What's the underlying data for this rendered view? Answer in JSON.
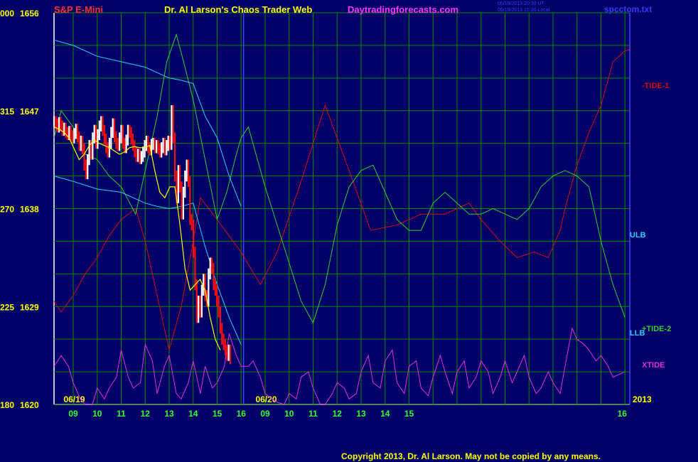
{
  "header": {
    "symbol": "S&P E-Mini",
    "title": "Dr. Al Larson's Chaos Trader Web",
    "site": "Daytradingforecasts.com",
    "stamp_ut": "06/19/2013 20:30 UT",
    "stamp_local": "06/19/2013 15:30 Local",
    "file": "spcctom.txt"
  },
  "footer": {
    "copyright": "Copyright 2013, Dr. Al Larson. May not be copied by any means."
  },
  "colors": {
    "background": "#000066",
    "grid": "#008800",
    "tide1": "#cc1111",
    "tide2": "#33cc33",
    "xtide": "#dd33dd",
    "bands": "#33ccff",
    "price_up": "#ffffff",
    "price_down": "#ee1111",
    "moving_avg": "#ffff00",
    "now_line": "#4444ff"
  },
  "chart_data": {
    "type": "line",
    "x_unit": "hour of day (two sessions, 06/19 and 06/20)",
    "y_left_labels": [
      {
        "left": "000",
        "right": "1656",
        "value": 1656
      },
      {
        "left": "315",
        "right": "1647",
        "value": 1647
      },
      {
        "left": "270",
        "right": "1638",
        "value": 1638
      },
      {
        "left": "225",
        "right": "1629",
        "value": 1629
      },
      {
        "left": "180",
        "right": "1620",
        "value": 1620
      }
    ],
    "ylim": [
      1620,
      1656
    ],
    "x_ticks": [
      "09",
      "10",
      "11",
      "12",
      "13",
      "14",
      "15",
      "16",
      "09",
      "10",
      "11",
      "12",
      "13",
      "14",
      "15",
      "16"
    ],
    "date_labels": [
      "06/19",
      "06/20"
    ],
    "year_label": "2013",
    "series_labels": [
      "-TIDE-1",
      "+TIDE-2",
      "ULB",
      "LLB",
      "XTIDE"
    ],
    "series": [
      {
        "name": "-TIDE-1",
        "x": [
          8.2,
          8.5,
          9.0,
          9.5,
          10.0,
          10.5,
          11.0,
          11.6,
          12.0,
          12.5,
          13.0,
          13.5,
          14.0,
          14.3,
          15.0,
          16.0,
          16.8,
          17.5,
          18.5,
          19.5,
          20.5,
          21.4,
          22.5,
          23.5,
          24.5,
          25.5,
          26.0,
          26.8,
          27.5,
          28.2,
          28.8,
          29.3,
          29.5,
          30.0,
          30.5,
          31.0,
          31.5,
          32.0,
          32.2
        ],
        "y": [
          1629.5,
          1628.5,
          1630.0,
          1632.0,
          1633.5,
          1635.5,
          1637.0,
          1638.0,
          1635.0,
          1630.0,
          1625.0,
          1629.0,
          1635.0,
          1639.0,
          1637.0,
          1634.0,
          1631.0,
          1634.0,
          1640.5,
          1647.5,
          1641.5,
          1636.0,
          1636.5,
          1637.5,
          1637.5,
          1638.5,
          1637.0,
          1635.0,
          1633.5,
          1634.0,
          1633.5,
          1636.0,
          1638.0,
          1642.0,
          1645.0,
          1647.5,
          1651.5,
          1652.5,
          1652.6
        ]
      },
      {
        "name": "+TIDE-2",
        "x": [
          8.2,
          8.5,
          9.0,
          9.5,
          10.0,
          10.5,
          11.0,
          11.6,
          12.0,
          12.5,
          12.9,
          13.3,
          13.6,
          14.0,
          14.5,
          15.0,
          15.4,
          15.8,
          16.0,
          16.3,
          17.0,
          17.5,
          18.0,
          18.5,
          19.0,
          19.5,
          20.0,
          20.5,
          21.0,
          21.5,
          22.0,
          22.5,
          23.0,
          23.5,
          24.0,
          24.5,
          25.0,
          25.5,
          26.0,
          26.5,
          27.0,
          27.5,
          28.0,
          28.5,
          29.0,
          29.5,
          30.0,
          30.5,
          31.0,
          31.5,
          32.0
        ],
        "y": [
          1644.5,
          1647.0,
          1645.5,
          1643.0,
          1642.5,
          1641.0,
          1640.0,
          1637.5,
          1641.5,
          1646.5,
          1651.5,
          1654.0,
          1651.5,
          1648.0,
          1642.5,
          1637.0,
          1639.5,
          1643.0,
          1644.5,
          1645.5,
          1640.0,
          1636.5,
          1633.0,
          1629.5,
          1627.5,
          1631.0,
          1636.5,
          1640.0,
          1641.5,
          1642.0,
          1639.5,
          1637.0,
          1636.0,
          1636.0,
          1638.5,
          1639.5,
          1638.5,
          1637.5,
          1637.5,
          1638.0,
          1637.5,
          1637.0,
          1638.0,
          1640.0,
          1641.0,
          1641.5,
          1641.0,
          1640.0,
          1635.0,
          1631.0,
          1628.0
        ]
      },
      {
        "name": "XTIDE",
        "x": [
          8.2,
          8.5,
          8.8,
          9.0,
          9.3,
          9.5,
          9.8,
          10.0,
          10.3,
          10.5,
          10.8,
          11.0,
          11.3,
          11.5,
          11.8,
          12.0,
          12.3,
          12.5,
          12.8,
          13.0,
          13.3,
          13.5,
          13.8,
          14.0,
          14.3,
          14.5,
          14.8,
          15.0,
          15.3,
          15.5,
          15.8,
          16.0,
          16.3,
          16.5,
          16.8,
          17.0,
          17.3,
          17.5,
          17.8,
          18.0,
          18.3,
          18.5,
          18.8,
          19.0,
          19.3,
          19.5,
          19.8,
          20.0,
          20.3,
          20.5,
          20.8,
          21.0,
          21.3,
          21.5,
          21.8,
          22.0,
          22.3,
          22.5,
          22.8,
          23.0,
          23.3,
          23.5,
          23.8,
          24.0,
          24.3,
          24.5,
          24.8,
          25.0,
          25.3,
          25.5,
          25.8,
          26.0,
          26.3,
          26.5,
          26.8,
          27.0,
          27.3,
          27.5,
          27.8,
          28.0,
          28.3,
          28.5,
          28.8,
          29.0,
          29.3,
          29.5,
          29.8,
          30.0,
          30.3,
          30.5,
          30.8,
          31.0,
          31.3,
          31.5,
          31.8,
          32.0
        ],
        "y": [
          1623.5,
          1624.5,
          1623.5,
          1622.0,
          1620.5,
          1620.0,
          1620.0,
          1621.5,
          1620.5,
          1621.5,
          1622.5,
          1625.0,
          1622.5,
          1621.5,
          1622.0,
          1625.5,
          1624.0,
          1621.0,
          1623.5,
          1624.5,
          1621.0,
          1620.5,
          1622.0,
          1624.0,
          1621.0,
          1623.5,
          1621.5,
          1622.0,
          1623.5,
          1626.5,
          1624.5,
          1623.5,
          1623.5,
          1624.0,
          1622.5,
          1621.0,
          1620.5,
          1620.2,
          1620.0,
          1621.0,
          1620.5,
          1622.5,
          1623.0,
          1621.5,
          1620.0,
          1620.0,
          1621.0,
          1622.0,
          1621.5,
          1620.5,
          1621.0,
          1623.0,
          1624.5,
          1622.0,
          1621.5,
          1624.0,
          1625.0,
          1622.0,
          1621.0,
          1623.5,
          1624.0,
          1621.5,
          1620.8,
          1622.5,
          1624.5,
          1623.0,
          1621.0,
          1623.0,
          1624.0,
          1621.5,
          1622.5,
          1624.0,
          1623.0,
          1621.0,
          1622.5,
          1624.0,
          1622.0,
          1623.0,
          1624.5,
          1622.5,
          1621.0,
          1621.5,
          1623.0,
          1622.0,
          1621.0,
          1623.5,
          1627.0,
          1626.0,
          1625.5,
          1625.0,
          1624.0,
          1624.5,
          1623.5,
          1622.5,
          1622.8,
          1623.0
        ]
      },
      {
        "name": "ULB",
        "x": [
          8.2,
          9.0,
          10.0,
          11.0,
          12.0,
          12.5,
          13.0,
          13.5,
          14.0,
          14.5,
          15.0,
          15.5,
          16.0
        ],
        "y": [
          1653.5,
          1653.0,
          1652.0,
          1651.5,
          1651.0,
          1650.5,
          1650.0,
          1649.8,
          1649.5,
          1646.5,
          1644.5,
          1641.0,
          1638.2
        ]
      },
      {
        "name": "LLB",
        "x": [
          8.2,
          9.0,
          10.0,
          11.0,
          12.0,
          12.5,
          13.0,
          13.5,
          14.0,
          14.5,
          15.0,
          15.5,
          16.0
        ],
        "y": [
          1641.0,
          1640.5,
          1639.8,
          1639.5,
          1638.5,
          1638.2,
          1638.0,
          1638.2,
          1638.5,
          1634.5,
          1631.0,
          1628.0,
          1625.5
        ]
      }
    ],
    "price": {
      "x_start": 8.2,
      "x_step": 0.07,
      "close": [
        1646.0,
        1645.8,
        1645.5,
        1645.9,
        1645.6,
        1645.2,
        1645.4,
        1645.0,
        1644.8,
        1645.1,
        1644.7,
        1644.5,
        1644.9,
        1645.3,
        1644.6,
        1643.8,
        1644.2,
        1643.5,
        1642.0,
        1641.2,
        1642.5,
        1643.8,
        1643.0,
        1644.5,
        1645.2,
        1644.0,
        1644.8,
        1645.6,
        1646.0,
        1645.2,
        1644.4,
        1643.6,
        1643.2,
        1644.0,
        1645.0,
        1645.8,
        1644.6,
        1644.0,
        1643.8,
        1644.5,
        1645.2,
        1644.0,
        1643.6,
        1644.3,
        1645.2,
        1645.0,
        1644.4,
        1643.8,
        1643.2,
        1642.8,
        1643.0,
        1642.6,
        1642.8,
        1643.2,
        1643.8,
        1644.2,
        1643.6,
        1643.4,
        1643.9,
        1644.0,
        1643.6,
        1643.8,
        1643.5,
        1643.2,
        1643.6,
        1644.0,
        1643.4,
        1643.8,
        1644.2,
        1643.9,
        1647.0,
        1644.5,
        1641.0,
        1639.0,
        1641.5,
        1640.0,
        1637.5,
        1639.5,
        1641.0,
        1642.0,
        1640.5,
        1637.0,
        1636.5,
        1634.0,
        1631.0,
        1628.0,
        1629.5,
        1628.5,
        1630.5,
        1631.5,
        1630.0,
        1629.5,
        1632.0,
        1633.0,
        1632.5,
        1631.0,
        1630.5,
        1629.5,
        1628.5,
        1627.0,
        1626.0,
        1625.5,
        1625.0,
        1624.5,
        1625.0,
        1624.2
      ],
      "moving_avg": [
        1645.5,
        1645.3,
        1645.0,
        1644.5,
        1643.5,
        1642.5,
        1643.0,
        1643.8,
        1644.3,
        1644.0,
        1643.8,
        1643.6,
        1643.3,
        1643.0,
        1643.2,
        1643.6,
        1643.7,
        1643.6,
        1643.6,
        1643.8,
        1641.5,
        1639.5,
        1639.0,
        1640.0,
        1640.0,
        1636.5,
        1632.5,
        1630.5,
        1631.0,
        1631.5,
        1630.5,
        1628.0,
        1626.0,
        1625.0
      ]
    },
    "now_x": 16.1
  }
}
